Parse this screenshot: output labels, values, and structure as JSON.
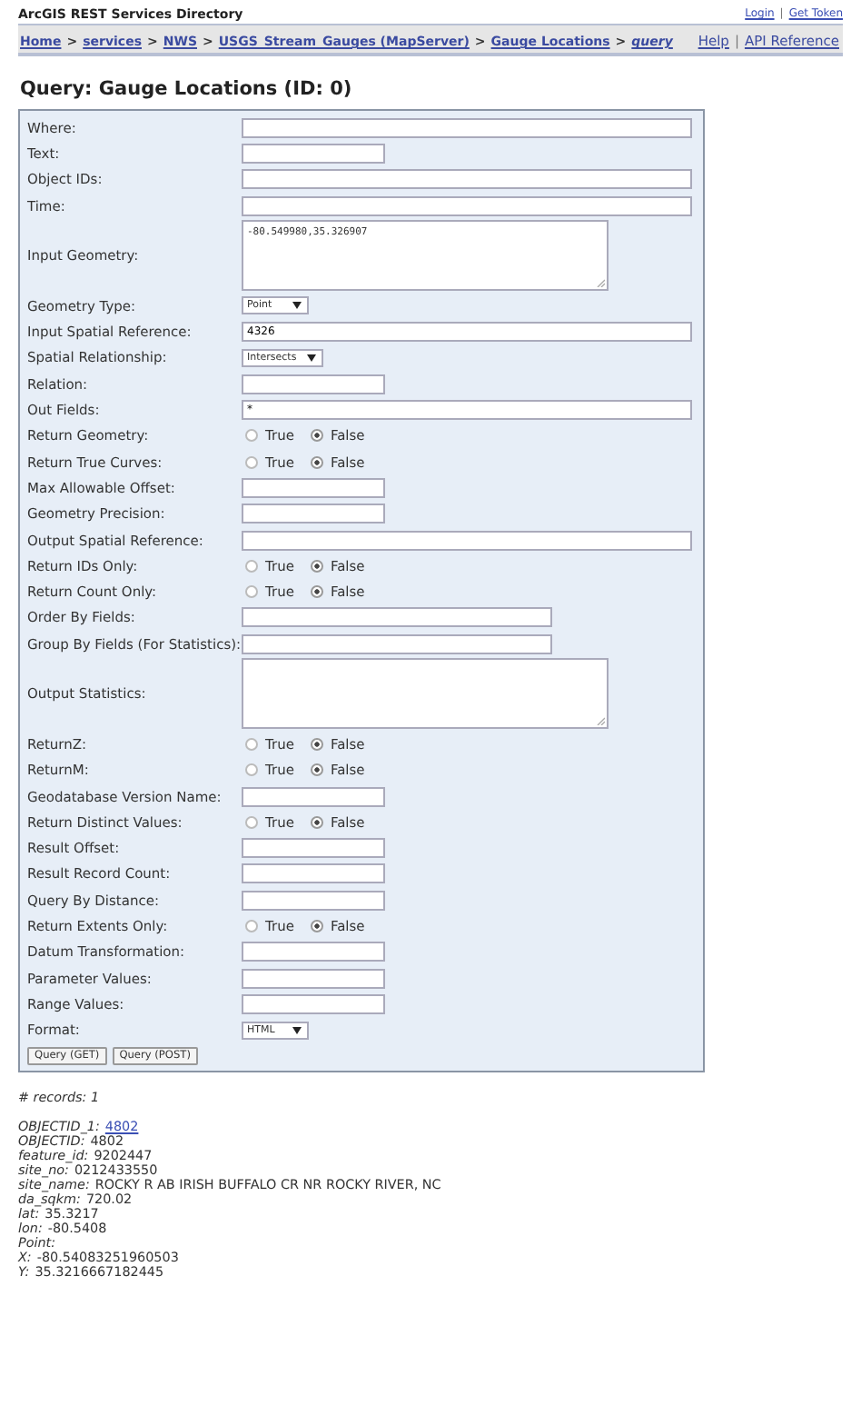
{
  "header": {
    "title": "ArcGIS REST Services Directory",
    "links": [
      "Login",
      "Get Token"
    ],
    "separator": "|"
  },
  "breadcrumb": {
    "items": [
      {
        "label": "Home",
        "italic": false
      },
      {
        "label": "services",
        "italic": false
      },
      {
        "label": "NWS",
        "italic": false
      },
      {
        "label": "USGS_Stream_Gauges (MapServer)",
        "italic": false
      },
      {
        "label": "Gauge Locations",
        "italic": false
      },
      {
        "label": "query",
        "italic": true
      }
    ],
    "separator": ">",
    "help_links": [
      "Help",
      "API Reference"
    ],
    "help_separator": "|"
  },
  "page_title": "Query: Gauge Locations (ID: 0)",
  "form": {
    "fields": [
      {
        "label": "Where:",
        "kind": "long"
      },
      {
        "label": "Text:",
        "kind": "short"
      },
      {
        "label": "Object IDs:",
        "kind": "long"
      },
      {
        "label": "Time:",
        "kind": "long"
      },
      {
        "label": "Input Geometry:",
        "kind": "textarea",
        "value": "-80.549980,35.326907"
      },
      {
        "label": "Geometry Type:",
        "kind": "select",
        "value": "Point"
      },
      {
        "label": "Input Spatial Reference:",
        "kind": "long",
        "value": "4326"
      },
      {
        "label": "Spatial Relationship:",
        "kind": "select",
        "value": "Intersects"
      },
      {
        "label": "Relation:",
        "kind": "short"
      },
      {
        "label": "Out Fields:",
        "kind": "long",
        "value": "*"
      },
      {
        "label": "Return Geometry:",
        "kind": "radio",
        "options": [
          {
            "label": "True",
            "selected": false
          },
          {
            "label": "False",
            "selected": true
          }
        ]
      },
      {
        "label": "Return True Curves:",
        "kind": "radio",
        "options": [
          {
            "label": "True",
            "selected": false
          },
          {
            "label": "False",
            "selected": true
          }
        ]
      },
      {
        "label": "Max Allowable Offset:",
        "kind": "short"
      },
      {
        "label": "Geometry Precision:",
        "kind": "short"
      },
      {
        "label": "Output Spatial Reference:",
        "kind": "long"
      },
      {
        "label": "Return IDs Only:",
        "kind": "radio",
        "options": [
          {
            "label": "True",
            "selected": false
          },
          {
            "label": "False",
            "selected": true
          }
        ]
      },
      {
        "label": "Return Count Only:",
        "kind": "radio",
        "options": [
          {
            "label": "True",
            "selected": false
          },
          {
            "label": "False",
            "selected": true
          }
        ]
      },
      {
        "label": "Order By Fields:",
        "kind": "medium"
      },
      {
        "label": "Group By Fields (For Statistics):",
        "kind": "medium"
      },
      {
        "label": "Output Statistics:",
        "kind": "textarea"
      },
      {
        "label": "ReturnZ:",
        "kind": "radio",
        "options": [
          {
            "label": "True",
            "selected": false
          },
          {
            "label": "False",
            "selected": true
          }
        ]
      },
      {
        "label": "ReturnM:",
        "kind": "radio",
        "options": [
          {
            "label": "True",
            "selected": false
          },
          {
            "label": "False",
            "selected": true
          }
        ]
      },
      {
        "label": "Geodatabase Version Name:",
        "kind": "short"
      },
      {
        "label": "Return Distinct Values:",
        "kind": "radio",
        "options": [
          {
            "label": "True",
            "selected": false
          },
          {
            "label": "False",
            "selected": true
          }
        ]
      },
      {
        "label": "Result Offset:",
        "kind": "short"
      },
      {
        "label": "Result Record Count:",
        "kind": "short"
      },
      {
        "label": "Query By Distance:",
        "kind": "short"
      },
      {
        "label": "Return Extents Only:",
        "kind": "radio",
        "options": [
          {
            "label": "True",
            "selected": false
          },
          {
            "label": "False",
            "selected": true
          }
        ]
      },
      {
        "label": "Datum Transformation:",
        "kind": "short"
      },
      {
        "label": "Parameter Values:",
        "kind": "short"
      },
      {
        "label": "Range Values:",
        "kind": "short"
      },
      {
        "label": "Format:",
        "kind": "select",
        "value": "HTML"
      }
    ],
    "buttons": [
      "Query (GET)",
      "Query (POST)"
    ]
  },
  "results": {
    "count_label": "# records: 1",
    "lines": [
      {
        "key": "OBJECTID_1:",
        "value": "4802",
        "kind": "link"
      },
      {
        "key": "OBJECTID:",
        "value": "4802",
        "kind": "text"
      },
      {
        "key": "feature_id:",
        "value": "9202447",
        "kind": "text"
      },
      {
        "key": "site_no:",
        "value": "0212433550",
        "kind": "text"
      },
      {
        "key": "site_name:",
        "value": "ROCKY R AB IRISH BUFFALO CR NR ROCKY RIVER, NC",
        "kind": "text"
      },
      {
        "key": "da_sqkm:",
        "value": "720.02",
        "kind": "text"
      },
      {
        "key": "lat:",
        "value": "35.3217",
        "kind": "text"
      },
      {
        "key": "lon:",
        "value": "-80.5408",
        "kind": "text"
      },
      {
        "key": "Point:"
      },
      {
        "key": "X:",
        "value": "-80.54083251960503",
        "kind": "text"
      },
      {
        "key": "Y:",
        "value": "35.3216667182445",
        "kind": "text"
      }
    ]
  }
}
